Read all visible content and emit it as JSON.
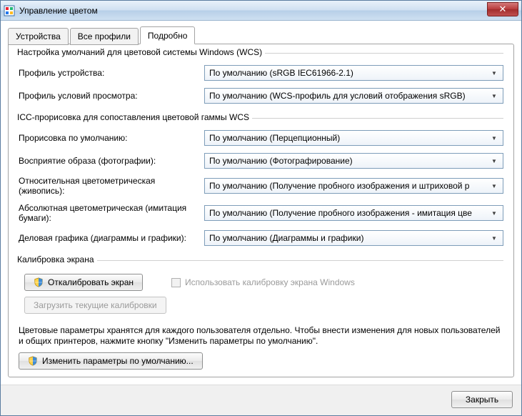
{
  "window": {
    "title": "Управление цветом"
  },
  "tabs": {
    "devices": "Устройства",
    "all_profiles": "Все профили",
    "advanced": "Подробно"
  },
  "groups": {
    "wcs_defaults": "Настройка умолчаний для цветовой системы Windows (WCS)",
    "icc_gamut": "ICC-прорисовка для сопоставления цветовой гаммы WCS",
    "calibration": "Калибровка экрана"
  },
  "labels": {
    "device_profile": "Профиль устройства:",
    "viewing_conditions": "Профиль условий просмотра:",
    "default_rendering": "Прорисовка по умолчанию:",
    "perceptual": "Восприятие образа (фотографии):",
    "rel_colorimetric": "Относительная цветометрическая (живопись):",
    "abs_colorimetric": "Абсолютная цветометрическая (имитация бумаги):",
    "business_graphics": "Деловая графика (диаграммы и графики):"
  },
  "values": {
    "device_profile": "По умолчанию (sRGB IEC61966-2.1)",
    "viewing_conditions": "По умолчанию (WCS-профиль для условий отображения sRGB)",
    "default_rendering": "По умолчанию (Перцепционный)",
    "perceptual": "По умолчанию (Фотографирование)",
    "rel_colorimetric": "По умолчанию (Получение пробного изображения и штриховой р",
    "abs_colorimetric": "По умолчанию (Получение пробного изображения - имитация цве",
    "business_graphics": "По умолчанию (Диаграммы и графики)"
  },
  "buttons": {
    "calibrate": "Откалибровать экран",
    "load_calibrations": "Загрузить текущие калибровки",
    "change_defaults": "Изменить параметры по умолчанию...",
    "close": "Закрыть"
  },
  "checkbox": {
    "use_windows_calibration": "Использовать калибровку экрана Windows"
  },
  "info_text": "Цветовые параметры хранятся для каждого пользователя отдельно. Чтобы внести изменения для новых пользователей и общих принтеров, нажмите кнопку \"Изменить параметры по умолчанию\"."
}
